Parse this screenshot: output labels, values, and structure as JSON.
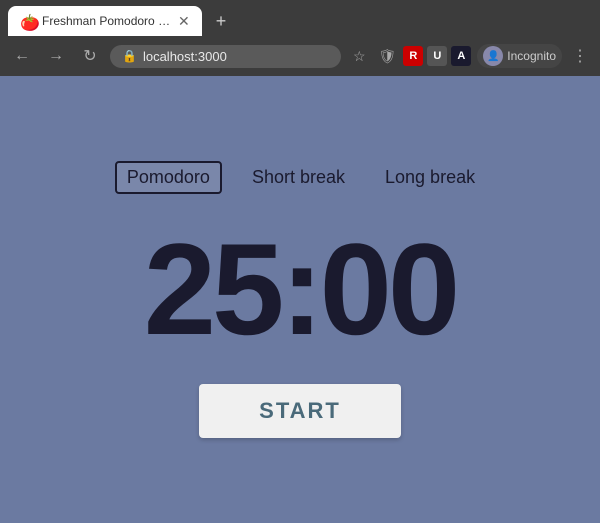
{
  "browser": {
    "tab": {
      "title": "Freshman Pomodoro Clo...",
      "favicon": "🍅"
    },
    "new_tab_label": "+",
    "address_bar": {
      "url": "localhost:3000",
      "lock_icon": "🔒"
    },
    "nav": {
      "back_label": "←",
      "forward_label": "→",
      "reload_label": "↻"
    },
    "profile": {
      "label": "Incognito"
    },
    "menu_label": "⋮"
  },
  "app": {
    "modes": [
      {
        "label": "Pomodoro",
        "active": true
      },
      {
        "label": "Short break",
        "active": false
      },
      {
        "label": "Long break",
        "active": false
      }
    ],
    "timer": {
      "display": "25:00"
    },
    "start_button": {
      "label": "START"
    }
  }
}
